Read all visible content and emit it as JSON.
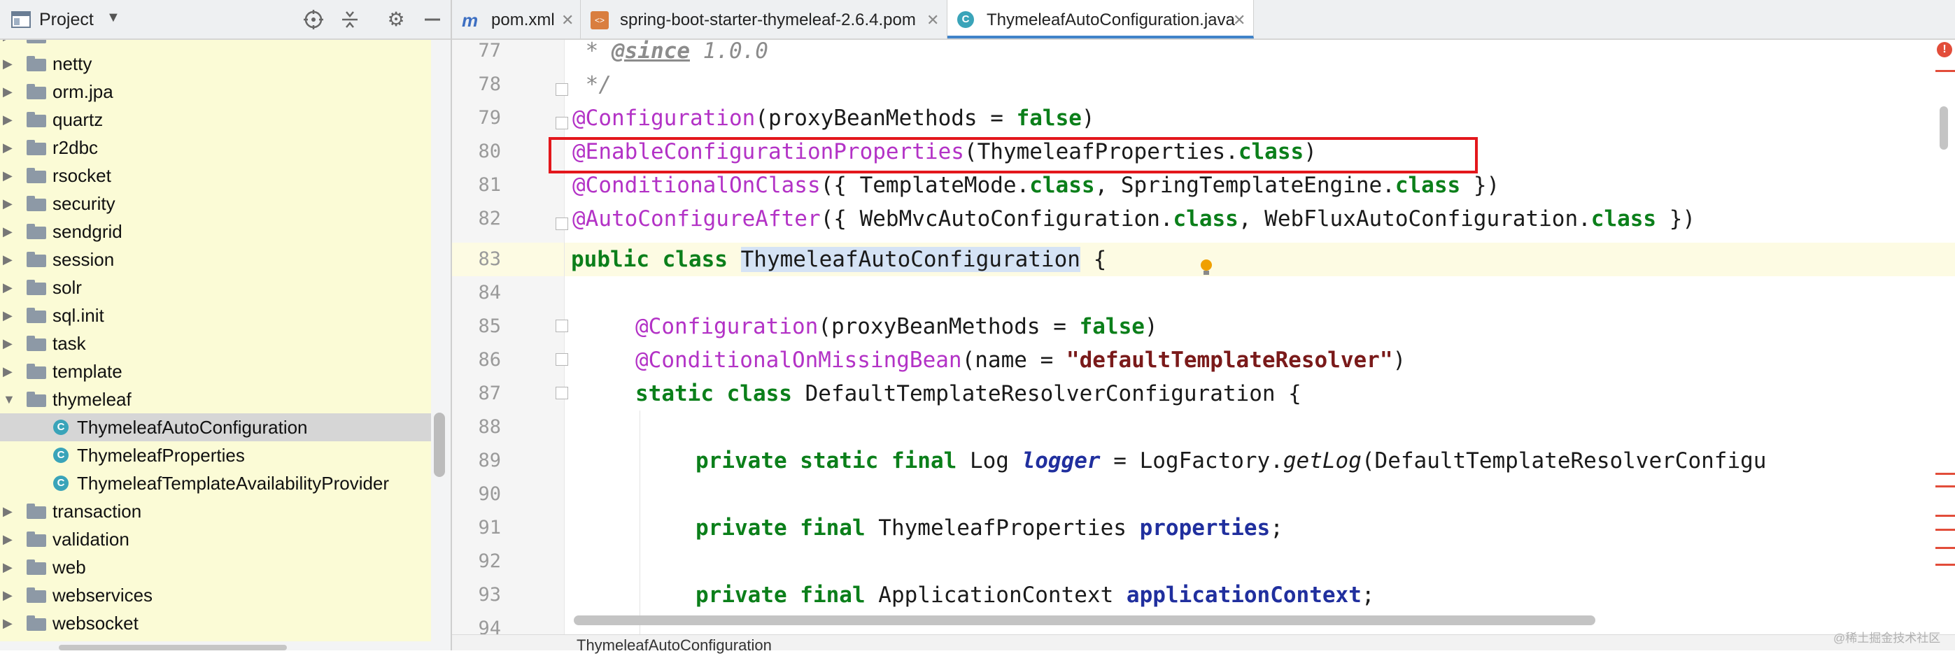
{
  "project_panel": {
    "title": "Project",
    "tree": [
      {
        "label": "netty",
        "kind": "folder"
      },
      {
        "label": "orm.jpa",
        "kind": "folder"
      },
      {
        "label": "quartz",
        "kind": "folder"
      },
      {
        "label": "r2dbc",
        "kind": "folder"
      },
      {
        "label": "rsocket",
        "kind": "folder"
      },
      {
        "label": "security",
        "kind": "folder"
      },
      {
        "label": "sendgrid",
        "kind": "folder"
      },
      {
        "label": "session",
        "kind": "folder"
      },
      {
        "label": "solr",
        "kind": "folder"
      },
      {
        "label": "sql.init",
        "kind": "folder"
      },
      {
        "label": "task",
        "kind": "folder"
      },
      {
        "label": "template",
        "kind": "folder"
      },
      {
        "label": "thymeleaf",
        "kind": "folder-open"
      },
      {
        "label": "ThymeleafAutoConfiguration",
        "kind": "class",
        "selected": true
      },
      {
        "label": "ThymeleafProperties",
        "kind": "class"
      },
      {
        "label": "ThymeleafTemplateAvailabilityProvider",
        "kind": "class"
      },
      {
        "label": "transaction",
        "kind": "folder"
      },
      {
        "label": "validation",
        "kind": "folder"
      },
      {
        "label": "web",
        "kind": "folder"
      },
      {
        "label": "webservices",
        "kind": "folder"
      },
      {
        "label": "websocket",
        "kind": "folder"
      }
    ]
  },
  "tabs": [
    {
      "label": "pom.xml",
      "icon": "maven-m-icon",
      "active": false
    },
    {
      "label": "spring-boot-starter-thymeleaf-2.6.4.pom",
      "icon": "pom-file-icon",
      "active": false
    },
    {
      "label": "ThymeleafAutoConfiguration.java",
      "icon": "java-class-icon",
      "active": true
    }
  ],
  "editor": {
    "line_numbers": [
      "77",
      "78",
      "79",
      "80",
      "81",
      "82",
      "83",
      "84",
      "85",
      "86",
      "87",
      "88",
      "89",
      "90",
      "91",
      "92",
      "93",
      "94"
    ],
    "lines": {
      "l77": {
        "a": " * ",
        "b": "@since",
        "c": " 1.0.0"
      },
      "l78": " */",
      "l79": {
        "ann": "@Configuration",
        "a": "(proxyBeanMethods = ",
        "kw": "false",
        "b": ")"
      },
      "l80": {
        "ann": "@EnableConfigurationProperties",
        "a": "(ThymeleafProperties.",
        "kw": "class",
        "b": ")"
      },
      "l81": {
        "ann": "@ConditionalOnClass",
        "a": "({ TemplateMode.",
        "kw1": "class",
        "b": ", SpringTemplateEngine.",
        "kw2": "class",
        "c": " })"
      },
      "l82": {
        "ann": "@AutoConfigureAfter",
        "a": "({ WebMvcAutoConfiguration.",
        "kw1": "class",
        "b": ", WebFluxAutoConfiguration.",
        "kw2": "class",
        "c": " })"
      },
      "l83": {
        "kw": "public class",
        "hl": "ThymeleafAutoConfiguration",
        "a": " {"
      },
      "l85": {
        "ann": "@Configuration",
        "a": "(proxyBeanMethods = ",
        "kw": "false",
        "b": ")"
      },
      "l86": {
        "ann": "@ConditionalOnMissingBean",
        "a": "(name = ",
        "str": "\"defaultTemplateResolver\"",
        "b": ")"
      },
      "l87": {
        "kw": "static class",
        "a": " DefaultTemplateResolverConfiguration {"
      },
      "l89": {
        "kw": "private static final",
        "a": " Log ",
        "sfld": "logger",
        "b": " = LogFactory.",
        "mth": "getLog",
        "c": "(DefaultTemplateResolverConfigu"
      },
      "l91": {
        "kw": "private final",
        "a": " ThymeleafProperties ",
        "fld": "properties",
        "b": ";"
      },
      "l93": {
        "kw": "private final",
        "a": " ApplicationContext ",
        "fld": "applicationContext",
        "b": ";"
      }
    }
  },
  "breadcrumb": "ThymeleafAutoConfiguration",
  "watermark": "@稀土掘金技术社区",
  "colors": {
    "keyword": "#0b7f1a",
    "annotation": "#b332c6",
    "highlight_box": "#e3171c",
    "tree_bg": "#fbfbd6"
  }
}
